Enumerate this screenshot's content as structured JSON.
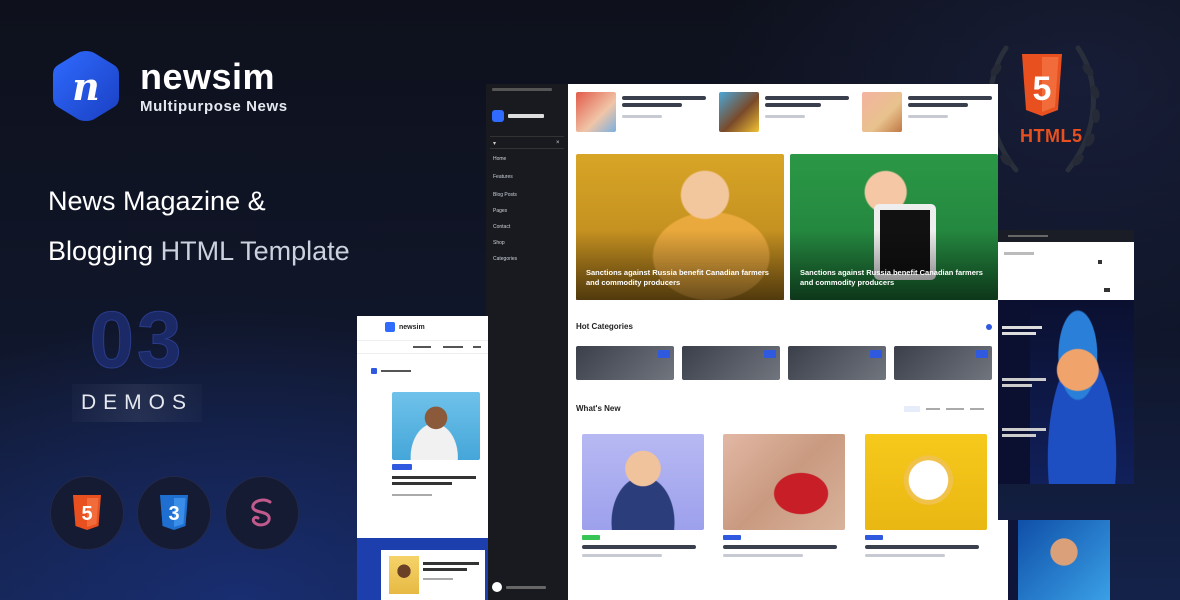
{
  "brand": {
    "name": "newsim",
    "tagline": "Multipurpose News",
    "logo_letter": "n",
    "logo_icon": "hexagon-n-icon",
    "colors": {
      "logo": "#1e4fd8",
      "logo_light": "#2f6bff"
    }
  },
  "headline": {
    "line1": "News Magazine &",
    "line2_strong": "Blogging",
    "line2_rest": " HTML Template"
  },
  "demos": {
    "count": "03",
    "label": "DEMOS"
  },
  "tech_icons": [
    {
      "name": "html5-icon",
      "color": "#e8501f"
    },
    {
      "name": "css3-icon",
      "color": "#1f6fd0"
    },
    {
      "name": "sass-icon",
      "color": "#c05a8c"
    }
  ],
  "badge": {
    "label": "HTML5",
    "icon": "html5-shield-icon",
    "color": "#e8501f"
  },
  "mock_main": {
    "hero_captions": [
      "Sanctions against Russia benefit Canadian farmers and commodity producers",
      "Sanctions against Russia benefit Canadian farmers and commodity producers"
    ],
    "hot_categories_title": "Hot Categories",
    "whats_new_title": "What's New",
    "colors": {
      "hero1": "#c8981e",
      "hero2": "#2f9a48",
      "accent": "#2f5ae0"
    }
  },
  "mock_sidebar": {
    "items": [
      "Home",
      "Features",
      "Blog Posts",
      "Pages",
      "Contact",
      "Shop",
      "Categories"
    ]
  },
  "mock_small": {
    "brand": "newsim"
  }
}
